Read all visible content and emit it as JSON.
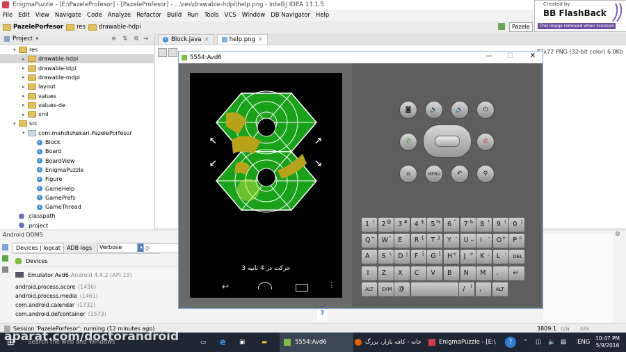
{
  "window": {
    "title": "EnigmaPuzzle - [E:\\PazeleProfesor] - [PazeleProfesor] - ...\\res\\drawable-hdpi\\help.png - IntelliJ IDEA 13.1.5"
  },
  "menu": [
    "File",
    "Edit",
    "View",
    "Navigate",
    "Code",
    "Analyze",
    "Refactor",
    "Build",
    "Run",
    "Tools",
    "VCS",
    "Window",
    "DB Navigator",
    "Help"
  ],
  "breadcrumbs": [
    "PazelePorfesor",
    "res",
    "drawable-hdpi"
  ],
  "toolbar_right": {
    "run_config": "Pazele"
  },
  "project_panel": {
    "title": "Project",
    "tree": [
      {
        "label": "res",
        "indent": 1,
        "type": "folder",
        "expanded": true
      },
      {
        "label": "drawable-hdpi",
        "indent": 2,
        "type": "folder",
        "selected": true
      },
      {
        "label": "drawable-ldpi",
        "indent": 2,
        "type": "folder"
      },
      {
        "label": "drawable-mdpi",
        "indent": 2,
        "type": "folder"
      },
      {
        "label": "layout",
        "indent": 2,
        "type": "folder"
      },
      {
        "label": "values",
        "indent": 2,
        "type": "folder"
      },
      {
        "label": "values-de",
        "indent": 2,
        "type": "folder"
      },
      {
        "label": "xml",
        "indent": 2,
        "type": "folder"
      },
      {
        "label": "src",
        "indent": 1,
        "type": "folder",
        "expanded": true
      },
      {
        "label": "com.mahdishekari.PazelePorfesor",
        "indent": 2,
        "type": "package",
        "expanded": true
      },
      {
        "label": "Block",
        "indent": 3,
        "type": "class"
      },
      {
        "label": "Board",
        "indent": 3,
        "type": "class"
      },
      {
        "label": "BoardView",
        "indent": 3,
        "type": "class"
      },
      {
        "label": "EnigmaPuzzle",
        "indent": 3,
        "type": "class"
      },
      {
        "label": "Figure",
        "indent": 3,
        "type": "class"
      },
      {
        "label": "GameHelp",
        "indent": 3,
        "type": "class"
      },
      {
        "label": "GamePrefs",
        "indent": 3,
        "type": "class"
      },
      {
        "label": "GameThread",
        "indent": 3,
        "type": "class"
      },
      {
        "label": ".classpath",
        "indent": 1,
        "type": "file"
      },
      {
        "label": ".project",
        "indent": 1,
        "type": "file"
      }
    ]
  },
  "editor": {
    "tabs": [
      {
        "label": "Block.java",
        "active": false
      },
      {
        "label": "help.png",
        "active": true
      }
    ],
    "image_info": "72x72 PNG (32-bit color) 6.0Kb"
  },
  "ddms": {
    "title": "Android DDMS",
    "tabs": [
      "Devices | logcat",
      "ADB logs"
    ],
    "log_level": "Verbose",
    "search_placeholder": "Q-",
    "devices_label": "Devices",
    "emulator": "Emulator Avd6",
    "emulator_detail": "Android 4.4.2 (API 19)",
    "processes": [
      {
        "name": "android.process.acore",
        "pid": "(1436)"
      },
      {
        "name": "android.process.media",
        "pid": "(1461)"
      },
      {
        "name": "com.android.calendar",
        "pid": "(1732)"
      },
      {
        "name": "com.android.defcontainer",
        "pid": "(1573)"
      }
    ],
    "help_glyph": "?"
  },
  "status": {
    "session": "Session 'PazelePorfesor': running (12 minutes ago)",
    "position": "3809:1",
    "na1": "n/a",
    "na2": "n/a"
  },
  "emulator_window": {
    "title": "5554:Avd6",
    "min": "—",
    "max": "☐",
    "close": "✕",
    "game_status": "3 حرکت در 4 ثانیه",
    "keyboard_rows": [
      [
        {
          "k": "1",
          "s": "!"
        },
        {
          "k": "2",
          "s": "@"
        },
        {
          "k": "3",
          "s": "#"
        },
        {
          "k": "4",
          "s": "$"
        },
        {
          "k": "5",
          "s": "%"
        },
        {
          "k": "6",
          "s": "^"
        },
        {
          "k": "7",
          "s": "&"
        },
        {
          "k": "8",
          "s": "*"
        },
        {
          "k": "9",
          "s": "("
        },
        {
          "k": "0",
          "s": ")"
        }
      ],
      [
        {
          "k": "Q",
          "s": "~"
        },
        {
          "k": "W",
          "s": "\""
        },
        {
          "k": "E",
          "s": "`"
        },
        {
          "k": "R",
          "s": "{"
        },
        {
          "k": "T",
          "s": "}"
        },
        {
          "k": "Y",
          "s": "-"
        },
        {
          "k": "U",
          "s": "_"
        },
        {
          "k": "I",
          "s": "-"
        },
        {
          "k": "O",
          "s": "+"
        },
        {
          "k": "P",
          "s": "="
        }
      ],
      [
        {
          "k": "A",
          "s": ""
        },
        {
          "k": "S",
          "s": "\\"
        },
        {
          "k": "D",
          "s": "|"
        },
        {
          "k": "F",
          "s": "["
        },
        {
          "k": "G",
          "s": "]"
        },
        {
          "k": "H",
          "s": "<"
        },
        {
          "k": "J",
          "s": ">"
        },
        {
          "k": "K",
          "s": ";"
        },
        {
          "k": "L",
          "s": ":"
        },
        {
          "k": "DEL",
          "s": ""
        }
      ],
      [
        {
          "k": "⇧",
          "s": ""
        },
        {
          "k": "Z",
          "s": ""
        },
        {
          "k": "X",
          "s": ""
        },
        {
          "k": "C",
          "s": ""
        },
        {
          "k": "V",
          "s": ""
        },
        {
          "k": "B",
          "s": ""
        },
        {
          "k": "N",
          "s": ""
        },
        {
          "k": "M",
          "s": ""
        },
        {
          "k": ".",
          "s": ""
        },
        {
          "k": "↵",
          "s": ""
        }
      ],
      [
        {
          "k": "ALT",
          "s": ""
        },
        {
          "k": "SYM",
          "s": ""
        },
        {
          "k": "@",
          "s": ""
        },
        {
          "k": "",
          "s": ""
        },
        {
          "k": "/",
          "s": "?"
        },
        {
          "k": ",",
          "s": ""
        },
        {
          "k": "ALT",
          "s": ""
        }
      ]
    ],
    "menu_key": "MENU"
  },
  "watermark": {
    "created_by": "Created by",
    "product": "BB FlashBack",
    "notice": "This image removed when licensed"
  },
  "overlay_text": "aparat.com/doctorandroid",
  "taskbar": {
    "search_placeholder": "Search the web and Windows",
    "emu_item": "5554:Avd6",
    "firefox_item": "خانه - کافه بازار، بزرگ",
    "idea_item": "EnigmaPuzzle - [E:\\",
    "lang": "ENG",
    "time": "10:47 PM",
    "date": "5/9/2016"
  },
  "colors": {
    "board_green": "#1aa11a",
    "board_olive": "#b8a21a",
    "taskbar": "#1e2733",
    "emu_frame": "#6a6a6a"
  }
}
